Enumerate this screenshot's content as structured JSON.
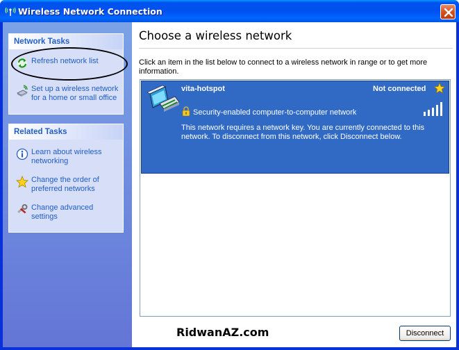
{
  "window": {
    "title": "Wireless Network Connection",
    "title_icon": "wireless-antenna-icon",
    "close_icon": "close-icon"
  },
  "sidebar": {
    "network_tasks": {
      "header": "Network Tasks",
      "items": [
        {
          "label": "Refresh network list",
          "icon": "refresh-icon"
        },
        {
          "label": "Set up a wireless network for a home or small office",
          "icon": "wireless-setup-icon"
        }
      ]
    },
    "related_tasks": {
      "header": "Related Tasks",
      "items": [
        {
          "label": "Learn about wireless networking",
          "icon": "info-icon"
        },
        {
          "label": "Change the order of preferred networks",
          "icon": "star-icon"
        },
        {
          "label": "Change advanced settings",
          "icon": "settings-tools-icon"
        }
      ]
    }
  },
  "main": {
    "heading": "Choose a wireless network",
    "instructions": "Click an item in the list below to connect to a wireless network in range or to get more information.",
    "networks": [
      {
        "ssid": "vita-hotspot",
        "status": "Not connected",
        "security": "Security-enabled computer-to-computer network",
        "description": "This network requires a network key. You are currently connected to this network. To disconnect from this network, click Disconnect below.",
        "signal_bars": 5,
        "preferred": true
      }
    ],
    "watermark": "RidwanAZ.com",
    "disconnect_label": "Disconnect"
  },
  "colors": {
    "titlebar": "#0054e3",
    "taskpane": "#7ba2e7",
    "selection": "#316ac5",
    "task_link": "#215dc6"
  }
}
